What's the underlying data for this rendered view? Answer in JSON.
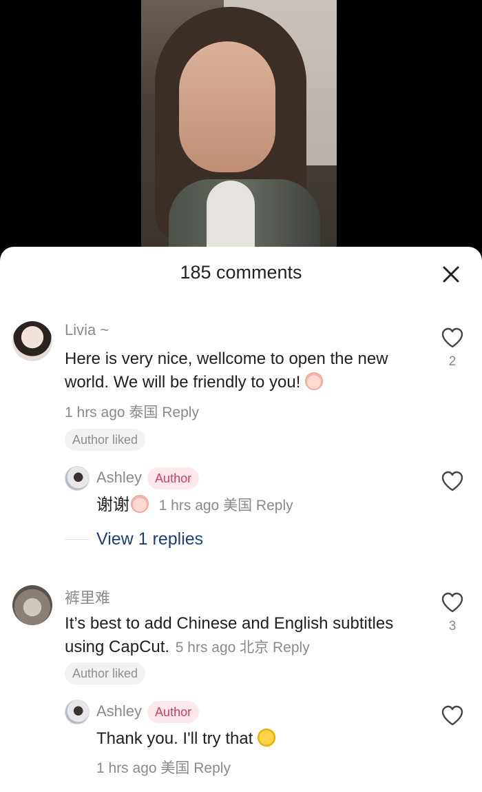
{
  "sheet": {
    "count_label": "185 comments"
  },
  "comments": [
    {
      "username": "Livia ~",
      "text_line1": "Here is very nice, wellcome to open the new",
      "text_line2": "world. We will be friendly to you!",
      "time": "1 hrs ago",
      "location": "泰国",
      "reply_label": "Reply",
      "liked_tag": "Author liked",
      "likes": "2",
      "reply": {
        "username": "Ashley",
        "author_tag": "Author",
        "text": "谢谢",
        "time": "1 hrs ago",
        "location": "美国",
        "reply_label": "Reply"
      },
      "view_replies": "View 1 replies"
    },
    {
      "username": "裤里难",
      "text_line1": "It’s best to add Chinese and English subtitles",
      "text_line2": "using CapCut.",
      "time": "5 hrs ago",
      "location": "北京",
      "reply_label": "Reply",
      "liked_tag": "Author liked",
      "likes": "3",
      "reply": {
        "username": "Ashley",
        "author_tag": "Author",
        "text": "Thank you. I'll try that",
        "time": "1 hrs ago",
        "location": "美国",
        "reply_label": "Reply"
      }
    }
  ],
  "icons": {
    "close": "close-icon",
    "heart": "heart-outline-icon"
  },
  "colors": {
    "author_tag_bg": "#fde9ec",
    "author_tag_text": "#d0405a",
    "link_blue": "#1d3f78"
  }
}
